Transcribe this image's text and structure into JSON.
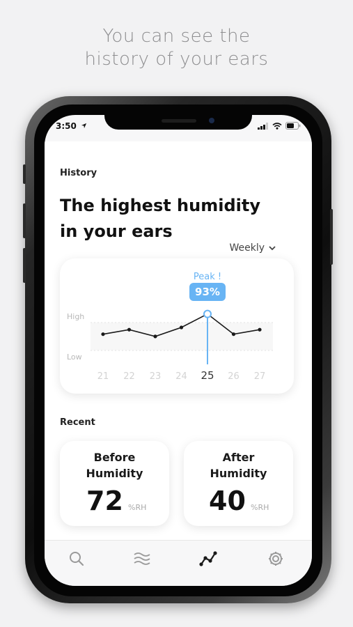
{
  "tagline": {
    "line1": "You can see the",
    "line2": "history of your ears"
  },
  "status_bar": {
    "time": "3:50",
    "location_icon": "location-arrow-icon",
    "icons": [
      "signal-icon",
      "wifi-icon",
      "battery-icon"
    ]
  },
  "history": {
    "section_label": "History",
    "headline_line1": "The highest humidity",
    "headline_line2": "in your ears",
    "range_selector": "Weekly"
  },
  "chart_data": {
    "type": "line",
    "x": [
      "21",
      "22",
      "23",
      "24",
      "25",
      "26",
      "27"
    ],
    "series": [
      {
        "values": [
          84,
          86,
          83,
          87,
          93,
          84,
          86
        ]
      }
    ],
    "ylim": [
      0,
      100
    ],
    "y_band_labels": [
      "High",
      "Low"
    ],
    "highlight": {
      "x": "25",
      "label": "Peak !",
      "value_label": "93%"
    },
    "colors": {
      "line": "#1a1a1a",
      "highlight": "#68b4f4",
      "badge_text": "#ffffff"
    }
  },
  "recent": {
    "section_label": "Recent",
    "before": {
      "title_line1": "Before",
      "title_line2": "Humidity",
      "value": "72",
      "unit": "%RH"
    },
    "after": {
      "title_line1": "After",
      "title_line2": "Humidity",
      "value": "40",
      "unit": "%RH"
    }
  },
  "tab_bar": {
    "tabs": [
      "search-icon",
      "waves-icon",
      "graph-icon",
      "gear-icon"
    ],
    "active": "graph-icon"
  }
}
